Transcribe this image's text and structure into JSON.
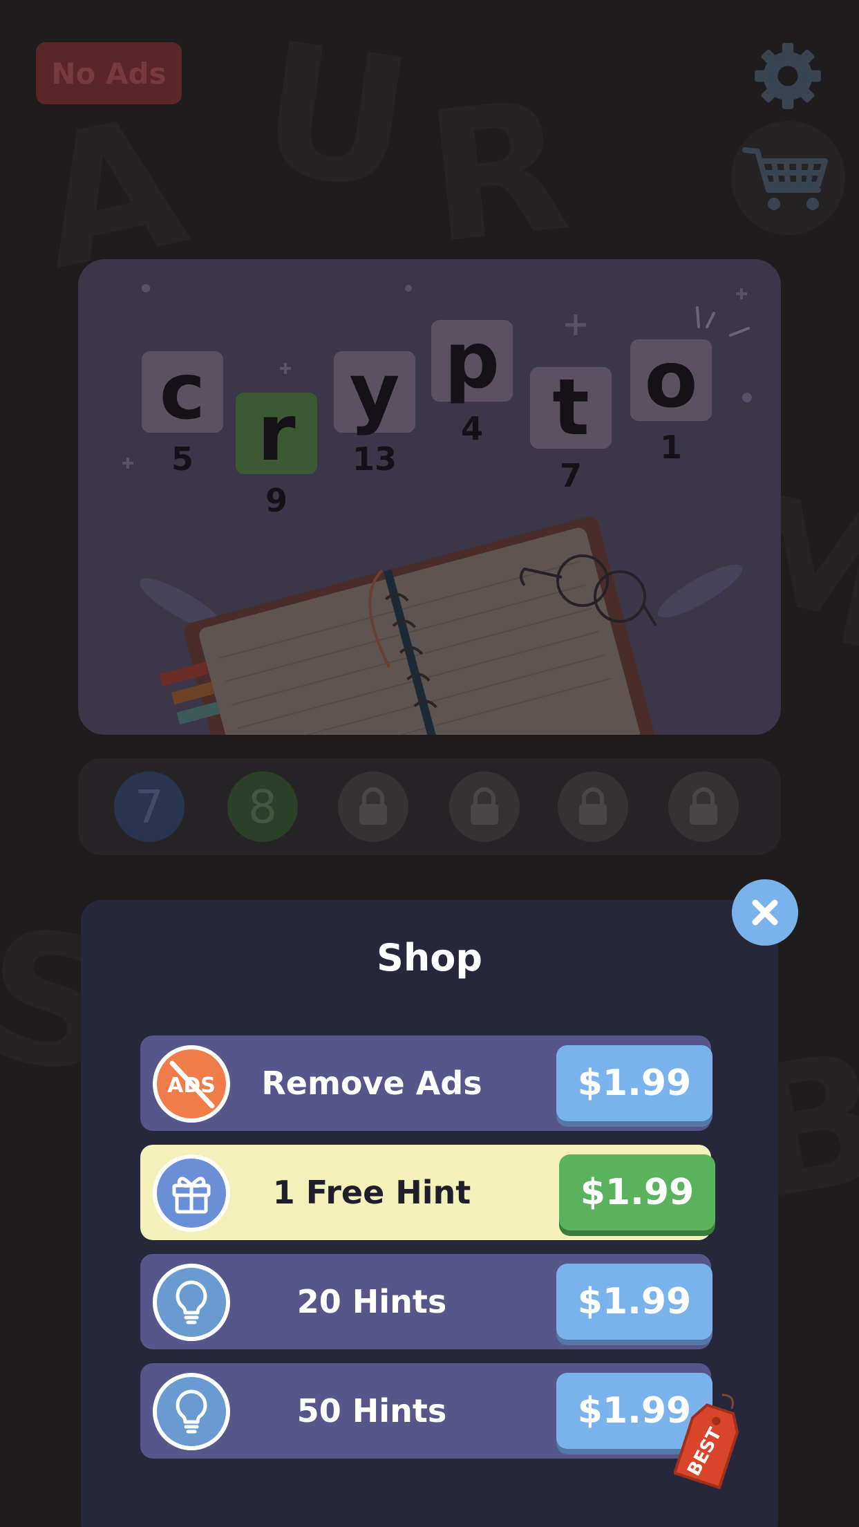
{
  "header": {
    "no_ads_label": "No Ads",
    "settings_icon": "gear-icon",
    "shop_icon": "cart-icon"
  },
  "puzzle": {
    "tiles": [
      {
        "letter": "c",
        "number": "5"
      },
      {
        "letter": "r",
        "number": "9"
      },
      {
        "letter": "y",
        "number": "13"
      },
      {
        "letter": "p",
        "number": "4"
      },
      {
        "letter": "t",
        "number": "7"
      },
      {
        "letter": "o",
        "number": "1"
      }
    ]
  },
  "levels": [
    {
      "label": "7",
      "state": "blue"
    },
    {
      "label": "8",
      "state": "green"
    },
    {
      "label": "",
      "state": "locked"
    },
    {
      "label": "",
      "state": "locked"
    },
    {
      "label": "",
      "state": "locked"
    },
    {
      "label": "",
      "state": "locked"
    }
  ],
  "shop": {
    "title": "Shop",
    "items": [
      {
        "icon": "no-ads-icon",
        "icon_text": "ADS",
        "label": "Remove Ads",
        "price": "$1.99"
      },
      {
        "icon": "gift-icon",
        "label": "1 Free Hint",
        "price": "$1.99"
      },
      {
        "icon": "lightbulb-icon",
        "label": "20 Hints",
        "price": "$1.99"
      },
      {
        "icon": "lightbulb-icon",
        "label": "50 Hints",
        "price": "$1.99"
      }
    ],
    "best_tag": "BEST"
  },
  "colors": {
    "accent_blue": "#7ab3ec",
    "accent_green": "#5bb25c",
    "row_purple": "#57568a",
    "row_highlight": "#f3f0b9",
    "modal_bg": "#27273c"
  }
}
